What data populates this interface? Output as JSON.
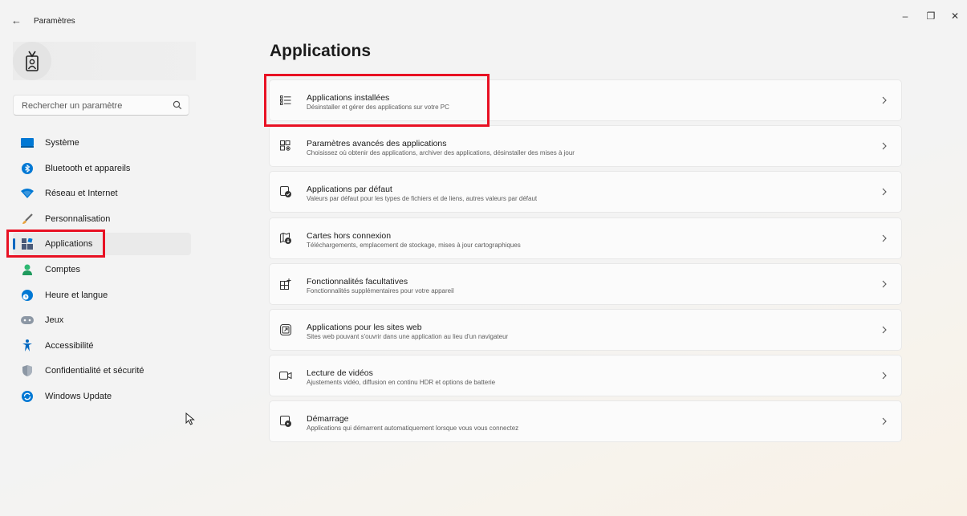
{
  "window": {
    "title": "Paramètres",
    "back_glyph": "←",
    "minimize_glyph": "–",
    "maximize_glyph": "❐",
    "close_glyph": "✕"
  },
  "search": {
    "placeholder": "Rechercher un paramètre"
  },
  "sidebar": {
    "items": [
      {
        "label": "Système",
        "icon": "system-icon",
        "color": "#0078d4"
      },
      {
        "label": "Bluetooth et appareils",
        "icon": "bluetooth-icon",
        "color": "#0078d4"
      },
      {
        "label": "Réseau et Internet",
        "icon": "wifi-icon",
        "color": "#0078d4"
      },
      {
        "label": "Personnalisation",
        "icon": "brush-icon",
        "color": "#555555"
      },
      {
        "label": "Applications",
        "icon": "apps-icon",
        "color": "#4a5a78",
        "active": true
      },
      {
        "label": "Comptes",
        "icon": "account-icon",
        "color": "#2eb872"
      },
      {
        "label": "Heure et langue",
        "icon": "clock-globe-icon",
        "color": "#0078d4"
      },
      {
        "label": "Jeux",
        "icon": "gamepad-icon",
        "color": "#8c97a4"
      },
      {
        "label": "Accessibilité",
        "icon": "accessibility-icon",
        "color": "#0067c0"
      },
      {
        "label": "Confidentialité et sécurité",
        "icon": "shield-icon",
        "color": "#8c97a4"
      },
      {
        "label": "Windows Update",
        "icon": "update-icon",
        "color": "#0078d4"
      }
    ]
  },
  "main": {
    "title": "Applications",
    "cards": [
      {
        "title": "Applications installées",
        "subtitle": "Désinstaller et gérer des applications sur votre PC",
        "icon": "list-icon"
      },
      {
        "title": "Paramètres avancés des applications",
        "subtitle": "Choisissez où obtenir des applications, archiver des applications, désinstaller des mises à jour",
        "icon": "apps-gear-icon"
      },
      {
        "title": "Applications par défaut",
        "subtitle": "Valeurs par défaut pour les types de fichiers et de liens, autres valeurs par défaut",
        "icon": "default-apps-icon"
      },
      {
        "title": "Cartes hors connexion",
        "subtitle": "Téléchargements, emplacement de stockage, mises à jour cartographiques",
        "icon": "map-download-icon"
      },
      {
        "title": "Fonctionnalités facultatives",
        "subtitle": "Fonctionnalités supplémentaires pour votre appareil",
        "icon": "add-feature-icon"
      },
      {
        "title": "Applications pour les sites web",
        "subtitle": "Sites web pouvant s'ouvrir dans une application au lieu d'un navigateur",
        "icon": "open-link-icon"
      },
      {
        "title": "Lecture de vidéos",
        "subtitle": "Ajustements vidéo, diffusion en continu HDR et options de batterie",
        "icon": "video-icon"
      },
      {
        "title": "Démarrage",
        "subtitle": "Applications qui démarrent automatiquement lorsque vous vous connectez",
        "icon": "startup-icon"
      }
    ]
  },
  "annotations": {
    "highlight_color": "#e81123"
  }
}
